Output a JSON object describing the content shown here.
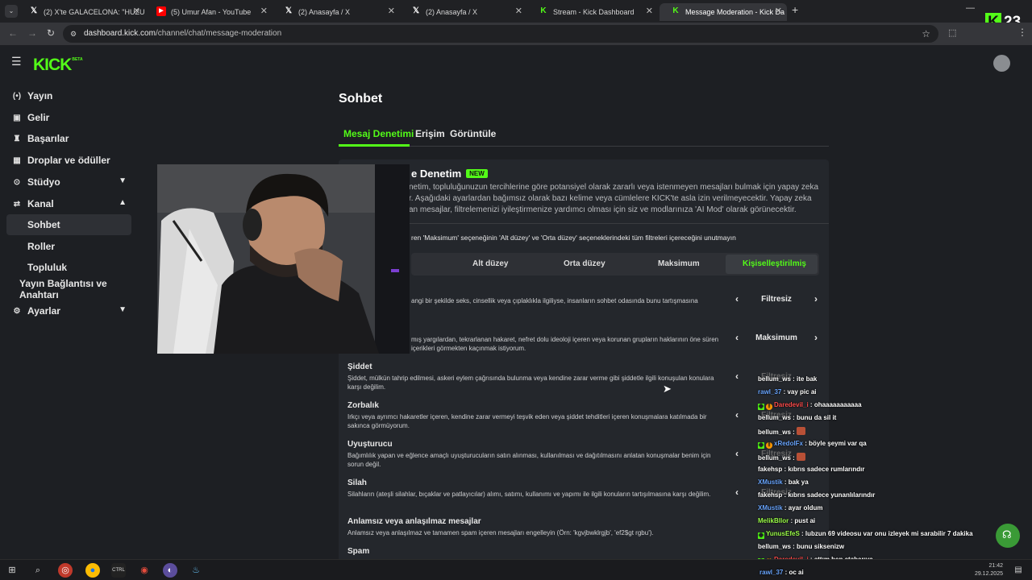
{
  "browser": {
    "tabs": [
      {
        "label": "(2) X'te GALACELONA: \"HUZUR",
        "icon": "x-icon"
      },
      {
        "label": "(5) Umur Afan - YouTube",
        "icon": "youtube-icon"
      },
      {
        "label": "(2) Anasayfa / X",
        "icon": "x-icon"
      },
      {
        "label": "(2) Anasayfa / X",
        "icon": "x-icon"
      },
      {
        "label": "Stream - Kick Dashboard",
        "icon": "kick-icon"
      },
      {
        "label": "Message Moderation - Kick Da",
        "icon": "kick-icon",
        "active": true
      }
    ],
    "url_host": "dashboard.kick.com",
    "url_path": "/channel/chat/message-moderation",
    "overlay_count": "23"
  },
  "sidebar": {
    "items": [
      {
        "label": "Yayın",
        "icon": "broadcast-icon"
      },
      {
        "label": "Gelir",
        "icon": "revenue-icon"
      },
      {
        "label": "Başarılar",
        "icon": "trophy-icon"
      },
      {
        "label": "Droplar ve ödüller",
        "icon": "drops-icon"
      },
      {
        "label": "Stüdyo",
        "icon": "studio-icon",
        "chevron": "down"
      },
      {
        "label": "Kanal",
        "icon": "channel-icon",
        "chevron": "up"
      },
      {
        "label": "Sohbet",
        "sub": true,
        "active": true
      },
      {
        "label": "Roller",
        "sub": true
      },
      {
        "label": "Topluluk",
        "sub": true
      },
      {
        "label": "Yayın Bağlantısı ve Anahtarı",
        "sub": true
      },
      {
        "label": "Ayarlar",
        "icon": "gear-icon",
        "chevron": "down"
      }
    ]
  },
  "main": {
    "title": "Sohbet",
    "tabs": [
      "Mesaj Denetimi",
      "Erişim",
      "Görüntüle"
    ],
    "card_title": "e Denetim",
    "badge": "NEW",
    "description": "netim, topluluğunuzun tercihlerine göre potansiyel olarak zararlı veya istenmeyen mesajları bulmak için yapay zeka r. Aşağıdaki ayarlardan bağımsız olarak bazı kelime veya cümlelere KICK'te asla izin verilmeyecektir. Yapay zeka an mesajlar, filtrelemenizi iyileştirmenize yardımcı olması için siz ve modlarınıza 'AI Mod' olarak görünecektir.",
    "notice": "ren 'Maksimum' seçeneğinin 'Alt düzey' ve 'Orta düzey' seçeneklerindeki tüm filtreleri içereceğini unutmayın",
    "levels": [
      "Alt düzey",
      "Orta düzey",
      "Maksimum",
      "Kişiselleştirilmiş"
    ],
    "rules": [
      {
        "title": "",
        "desc": "angi bir şekilde seks, cinsellik veya çıplaklıkla ilgiliyse, insanların sohbet odasında bunu tartışmasına",
        "value": "Filtresiz"
      },
      {
        "title": "",
        "desc": "mış yargılardan, tekrarlanan hakaret, nefret dolu ideoloji içeren veya korunan grupların haklarının öne süren içerikleri görmekten kaçınmak istiyorum.",
        "value": "Maksimum"
      },
      {
        "title": "Şiddet",
        "desc": "Şiddet, mülkün tahrip edilmesi, askeri eylem çağrısında bulunma veya kendine zarar verme gibi şiddetle ilgili konuşulan konulara karşı değilim.",
        "value": "Filtresiz"
      },
      {
        "title": "Zorbalık",
        "desc": "Irkçı veya ayrımcı hakaretler içeren, kendine zarar vermeyi teşvik eden veya şiddet tehditleri içeren konuşmalara katılmada bir sakınca görmüyorum.",
        "value": "Filtresiz"
      },
      {
        "title": "Uyuşturucu",
        "desc": "Bağımlılık yapan ve eğlence amaçlı uyuşturucuların satın alınması, kullanılması ve dağıtılmasını anlatan konuşmalar benim için sorun değil.",
        "value": "Filtresiz"
      },
      {
        "title": "Silah",
        "desc": "Silahların (ateşli silahlar, bıçaklar ve patlayıcılar) alımı, satımı, kullanımı ve yapımı ile ilgili konuların tartışılmasına karşı değilim.",
        "value": "Filtresiz"
      },
      {
        "title": "Anlamsız veya anlaşılmaz mesajlar",
        "desc": "Anlamsız veya anlaşılmaz ve tamamen spam içeren mesajları engelleyin (Örn: 'kgvjbwklrgjb', 'ef2$gt rgbu').",
        "value": ""
      },
      {
        "title": "Spam",
        "desc": "",
        "value": ""
      }
    ]
  },
  "chat": [
    {
      "user": "bellum_ws",
      "text": "ite bak",
      "color": "white"
    },
    {
      "user": "rawl_37",
      "text": "vay pic ai",
      "color": "blue"
    },
    {
      "user": "Daredevil_i",
      "text": "ohaaaaaaaaaaa",
      "color": "red",
      "badges": true
    },
    {
      "user": "bellum_ws",
      "text": "bunu da sil it",
      "color": "white"
    },
    {
      "user": "bellum_ws",
      "text": "",
      "color": "white",
      "emote": true
    },
    {
      "user": "xRedolFx",
      "text": "böyle şeymi var qa",
      "color": "blue",
      "badges": true
    },
    {
      "user": "bellum_ws",
      "text": "",
      "color": "white",
      "emote": true
    },
    {
      "user": "fakehsp",
      "text": "kıbrıs sadece rumlarındır",
      "color": "white"
    },
    {
      "user": "XMustik",
      "text": "bak ya",
      "color": "blue"
    },
    {
      "user": "fakehsp",
      "text": "kıbrıs sadece yunanlılarındır",
      "color": "white"
    },
    {
      "user": "XMustik",
      "text": "ayar oldum",
      "color": "blue"
    },
    {
      "user": "MelikBllor",
      "text": "pust ai",
      "color": "green"
    },
    {
      "user": "YunusEfeS",
      "text": "lubzun 69 videosu var onu izleyek mi sarabilir 7 dakika",
      "color": "green",
      "badges": true
    },
    {
      "user": "bellum_ws",
      "text": "bunu siksenizw",
      "color": "white"
    },
    {
      "user": "Daredevil_i",
      "text": "attım ben atabarıya",
      "color": "red",
      "badges": true
    },
    {
      "user": "rawl_37",
      "text": "oc ai",
      "color": "blue"
    }
  ],
  "taskbar": {
    "time": "21:42",
    "date": "29.12.2025"
  },
  "colors": {
    "accent": "#53fc18",
    "bg": "#1d1f23",
    "card": "#24272c"
  }
}
